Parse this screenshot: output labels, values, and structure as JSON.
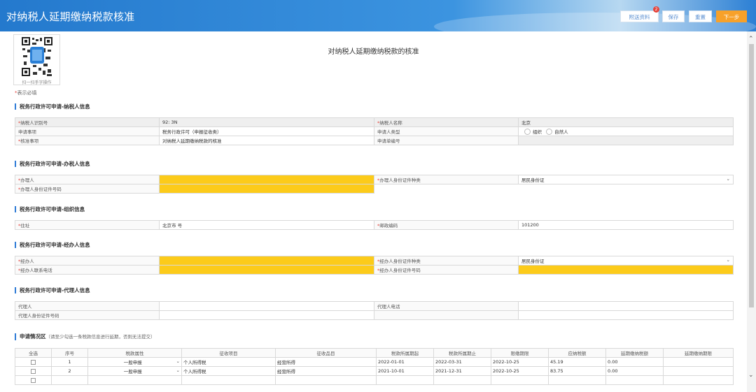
{
  "header": {
    "title": "对纳税人延期缴纳税款核准",
    "buttons": {
      "attach": "附送资料",
      "save": "保存",
      "reset": "重置",
      "next": "下一步"
    },
    "attach_badge": "2"
  },
  "doc": {
    "title": "对纳税人延期缴纳税款的核准",
    "qr_caption": "扫一扫手字操作",
    "required_note": "表示必填"
  },
  "sections": {
    "taxpayer": "税务行政许可申请-纳税人信息",
    "handler": "税务行政许可申请-办税人信息",
    "org": "税务行政许可申请-组织信息",
    "agent": "税务行政许可申请-经办人信息",
    "proxy": "税务行政许可申请-代理人信息",
    "apply": "申请情况区",
    "apply_note": "（请至少勾选一条税款信息进行延期，否则无法提交）"
  },
  "taxpayer": {
    "id_label": "纳税人识别号",
    "id_value": "92:                          3N",
    "name_label": "纳税人名称",
    "name_value": "北京",
    "item_label": "申请事项",
    "item_value": "税务行政许可（申报征收类）",
    "type_label": "申请人类型",
    "type_opt1": "组织",
    "type_opt2": "自然人",
    "approve_label": "核准事项",
    "approve_value": "对纳税人延期缴纳税款的核准",
    "order_label": "申请单编号",
    "order_value": ""
  },
  "handler": {
    "person_label": "办理人",
    "idtype_label": "办理人身份证件种类",
    "idtype_value": "居民身份证",
    "idno_label": "办理人身份证件号码"
  },
  "org": {
    "addr_label": "住址",
    "addr_value": "北京市                                     号",
    "post_label": "邮政编码",
    "post_value": "101200"
  },
  "agent": {
    "person_label": "经办人",
    "idtype_label": "经办人身份证件种类",
    "idtype_value": "居民身份证",
    "phone_label": "经办人联系电话",
    "idno_label": "经办人身份证件号码"
  },
  "proxy": {
    "person_label": "代理人",
    "phone_label": "代理人电话",
    "idno_label": "代理人身份证件号码"
  },
  "apply_table": {
    "headers": [
      "全选",
      "序号",
      "税款属性",
      "征收项目",
      "征收品目",
      "税款所属期起",
      "税款所属期止",
      "限缴期限",
      "应纳税额",
      "延期缴纳税额",
      "延期缴纳期限"
    ],
    "rows": [
      {
        "no": "1",
        "attr": "一般申报",
        "item": "个人所得税",
        "sub": "经营所得",
        "from": "2022-01-01",
        "to": "2022-03-31",
        "limit": "2022-10-25",
        "tax": "45.19",
        "delay": "0.00"
      },
      {
        "no": "2",
        "attr": "一般申报",
        "item": "个人所得税",
        "sub": "经营所得",
        "from": "2021-10-01",
        "to": "2021-12-31",
        "limit": "2022-10-25",
        "tax": "83.75",
        "delay": "0.00"
      }
    ]
  },
  "colors": {
    "header_blue": "#2479cd",
    "accent_orange": "#f7a12a",
    "required_yellow": "#fccb1a",
    "required_star": "#e5443c"
  }
}
